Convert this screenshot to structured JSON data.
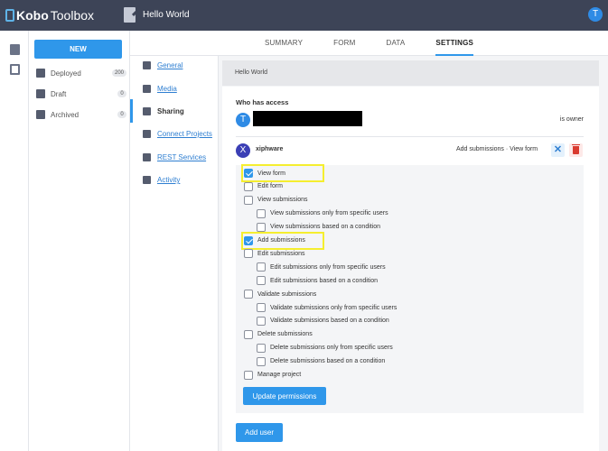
{
  "topbar": {
    "logo_kobo": "Kobo",
    "logo_toolbox": "Toolbox",
    "form_title": "Hello World",
    "avatar_letter": "T"
  },
  "sidebar": {
    "new_label": "NEW",
    "items": [
      {
        "label": "Deployed",
        "count": "200",
        "icon": "rocket-icon"
      },
      {
        "label": "Draft",
        "count": "0",
        "icon": "draft-icon"
      },
      {
        "label": "Archived",
        "count": "0",
        "icon": "archive-icon"
      }
    ]
  },
  "tabs": [
    "SUMMARY",
    "FORM",
    "DATA",
    "SETTINGS"
  ],
  "active_tab": "SETTINGS",
  "settings_nav": [
    {
      "label": "General",
      "icon": "general-icon"
    },
    {
      "label": "Media",
      "icon": "media-icon"
    },
    {
      "label": "Sharing",
      "icon": "add-person-icon"
    },
    {
      "label": "Connect Projects",
      "icon": "link-icon"
    },
    {
      "label": "REST Services",
      "icon": "rest-icon"
    },
    {
      "label": "Activity",
      "icon": "activity-icon"
    }
  ],
  "active_nav": "Sharing",
  "content": {
    "header": "Hello World",
    "access_title": "Who has access",
    "owner": {
      "avatar": "T",
      "label": "is owner"
    },
    "user": {
      "avatar": "X",
      "name": "xiphware",
      "perms_summary": "Add submissions · View form"
    },
    "permissions": [
      {
        "label": "View form",
        "checked": true,
        "indent": 0
      },
      {
        "label": "Edit form",
        "checked": false,
        "indent": 0
      },
      {
        "label": "View submissions",
        "checked": false,
        "indent": 0
      },
      {
        "label": "View submissions only from specific users",
        "checked": false,
        "indent": 1
      },
      {
        "label": "View submissions based on a condition",
        "checked": false,
        "indent": 1
      },
      {
        "label": "Add submissions",
        "checked": true,
        "indent": 0
      },
      {
        "label": "Edit submissions",
        "checked": false,
        "indent": 0
      },
      {
        "label": "Edit submissions only from specific users",
        "checked": false,
        "indent": 1
      },
      {
        "label": "Edit submissions based on a condition",
        "checked": false,
        "indent": 1
      },
      {
        "label": "Validate submissions",
        "checked": false,
        "indent": 0
      },
      {
        "label": "Validate submissions only from specific users",
        "checked": false,
        "indent": 1
      },
      {
        "label": "Validate submissions based on a condition",
        "checked": false,
        "indent": 1
      },
      {
        "label": "Delete submissions",
        "checked": false,
        "indent": 0
      },
      {
        "label": "Delete submissions only from specific users",
        "checked": false,
        "indent": 1
      },
      {
        "label": "Delete submissions based on a condition",
        "checked": false,
        "indent": 1
      },
      {
        "label": "Manage project",
        "checked": false,
        "indent": 0
      }
    ],
    "update_label": "Update permissions",
    "add_user_label": "Add user",
    "highlight_color": "#f5ee2f"
  }
}
